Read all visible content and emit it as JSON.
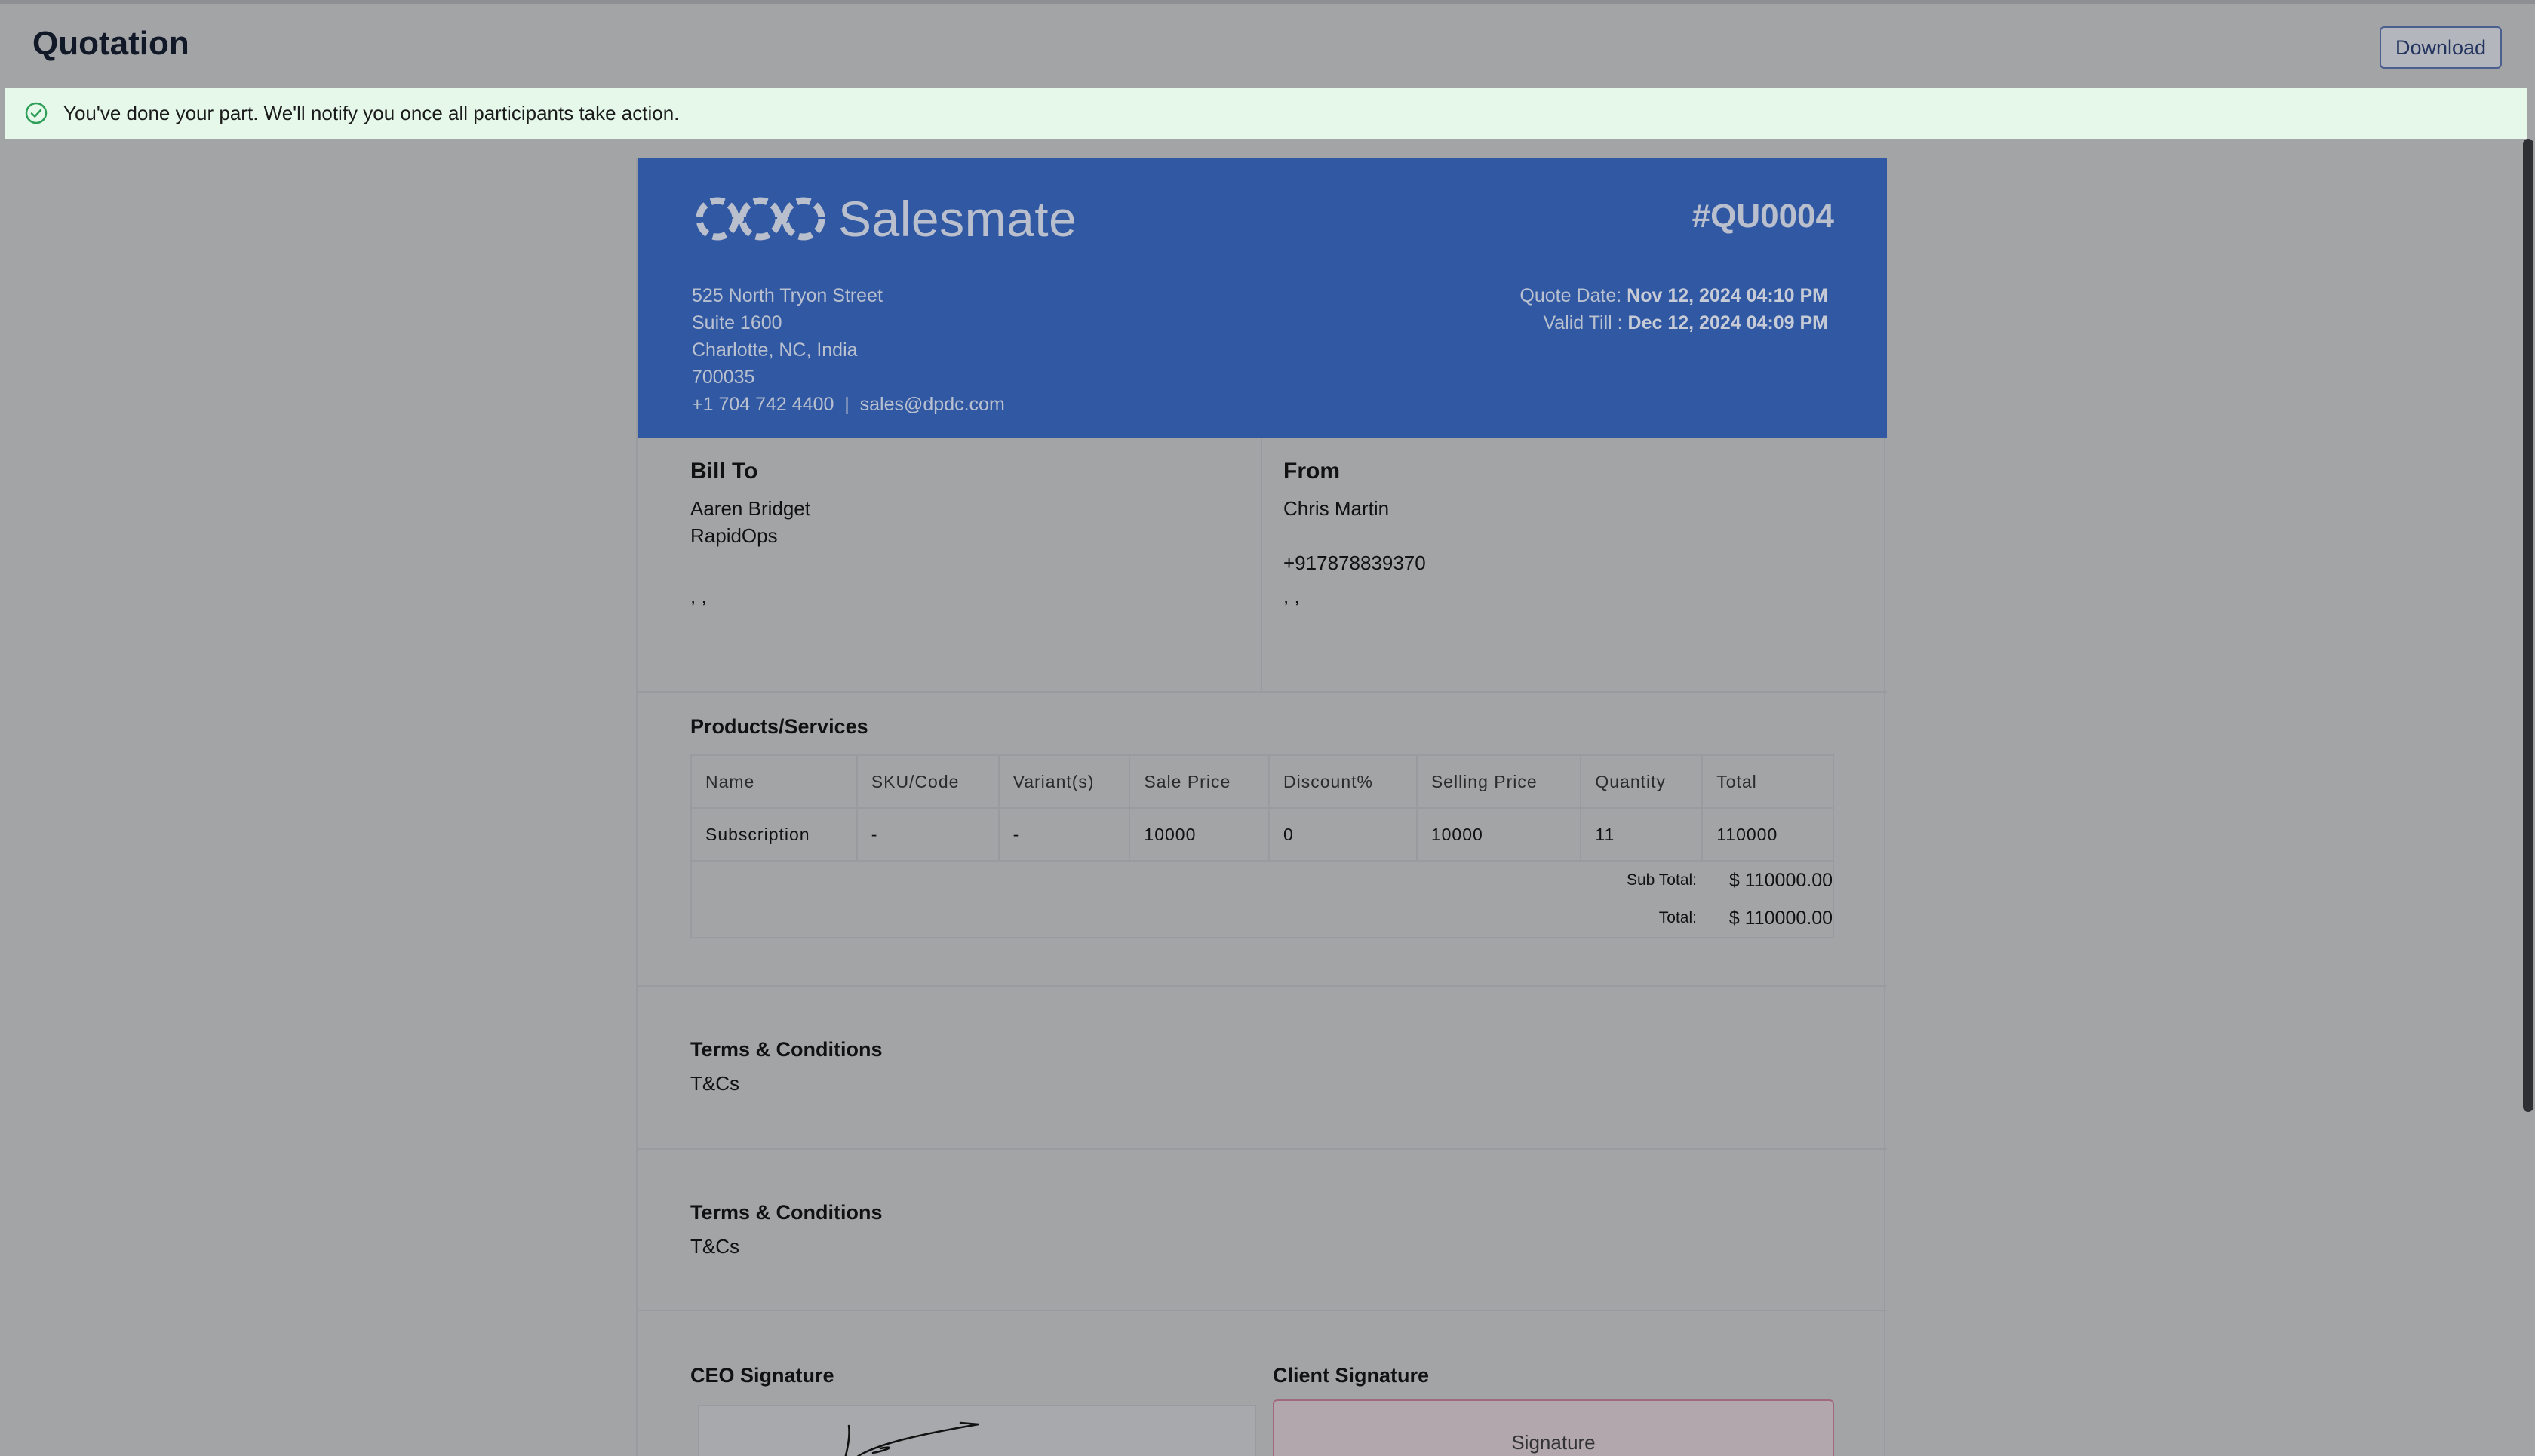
{
  "header": {
    "title": "Quotation",
    "download_label": "Download"
  },
  "banner": {
    "message": "You've done your part. We'll notify you once all participants take action.",
    "icon": "check-circle-icon"
  },
  "quote": {
    "brand": "Salesmate",
    "number": "#QU0004",
    "address": {
      "line1": "525 North Tryon Street",
      "line2": "Suite 1600",
      "line3": "Charlotte, NC, India",
      "line4": "700035",
      "contact": "+1 704 742 4400  |  sales@dpdc.com"
    },
    "quote_date_label": "Quote Date:",
    "quote_date": "Nov 12, 2024 04:10 PM",
    "valid_till_label": "Valid Till :",
    "valid_till": "Dec 12, 2024 04:09 PM"
  },
  "bill_to": {
    "heading": "Bill To",
    "name": "Aaren Bridget",
    "company": "RapidOps",
    "blank": "",
    "commas": ", ,"
  },
  "from": {
    "heading": "From",
    "name": "Chris Martin",
    "blank": "",
    "phone": "+917878839370",
    "commas": ", ,"
  },
  "products": {
    "title": "Products/Services",
    "columns": [
      "Name",
      "SKU/Code",
      "Variant(s)",
      "Sale Price",
      "Discount%",
      "Selling Price",
      "Quantity",
      "Total"
    ],
    "rows": [
      [
        "Subscription",
        "-",
        "-",
        "10000",
        "0",
        "10000",
        "11",
        "110000"
      ]
    ],
    "subtotal_label": "Sub Total:",
    "subtotal_value": "$ 110000.00",
    "total_label": "Total:",
    "total_value": "$ 110000.00"
  },
  "terms": [
    {
      "heading": "Terms & Conditions",
      "body": "T&Cs"
    },
    {
      "heading": "Terms & Conditions",
      "body": "T&Cs"
    }
  ],
  "signatures": {
    "ceo_label": "CEO Signature",
    "client_label": "Client Signature",
    "client_placeholder": "Signature"
  },
  "colors": {
    "brand_header": "#3158a2",
    "banner_bg": "#e5f8ea",
    "success_icon": "#2e9e58"
  }
}
